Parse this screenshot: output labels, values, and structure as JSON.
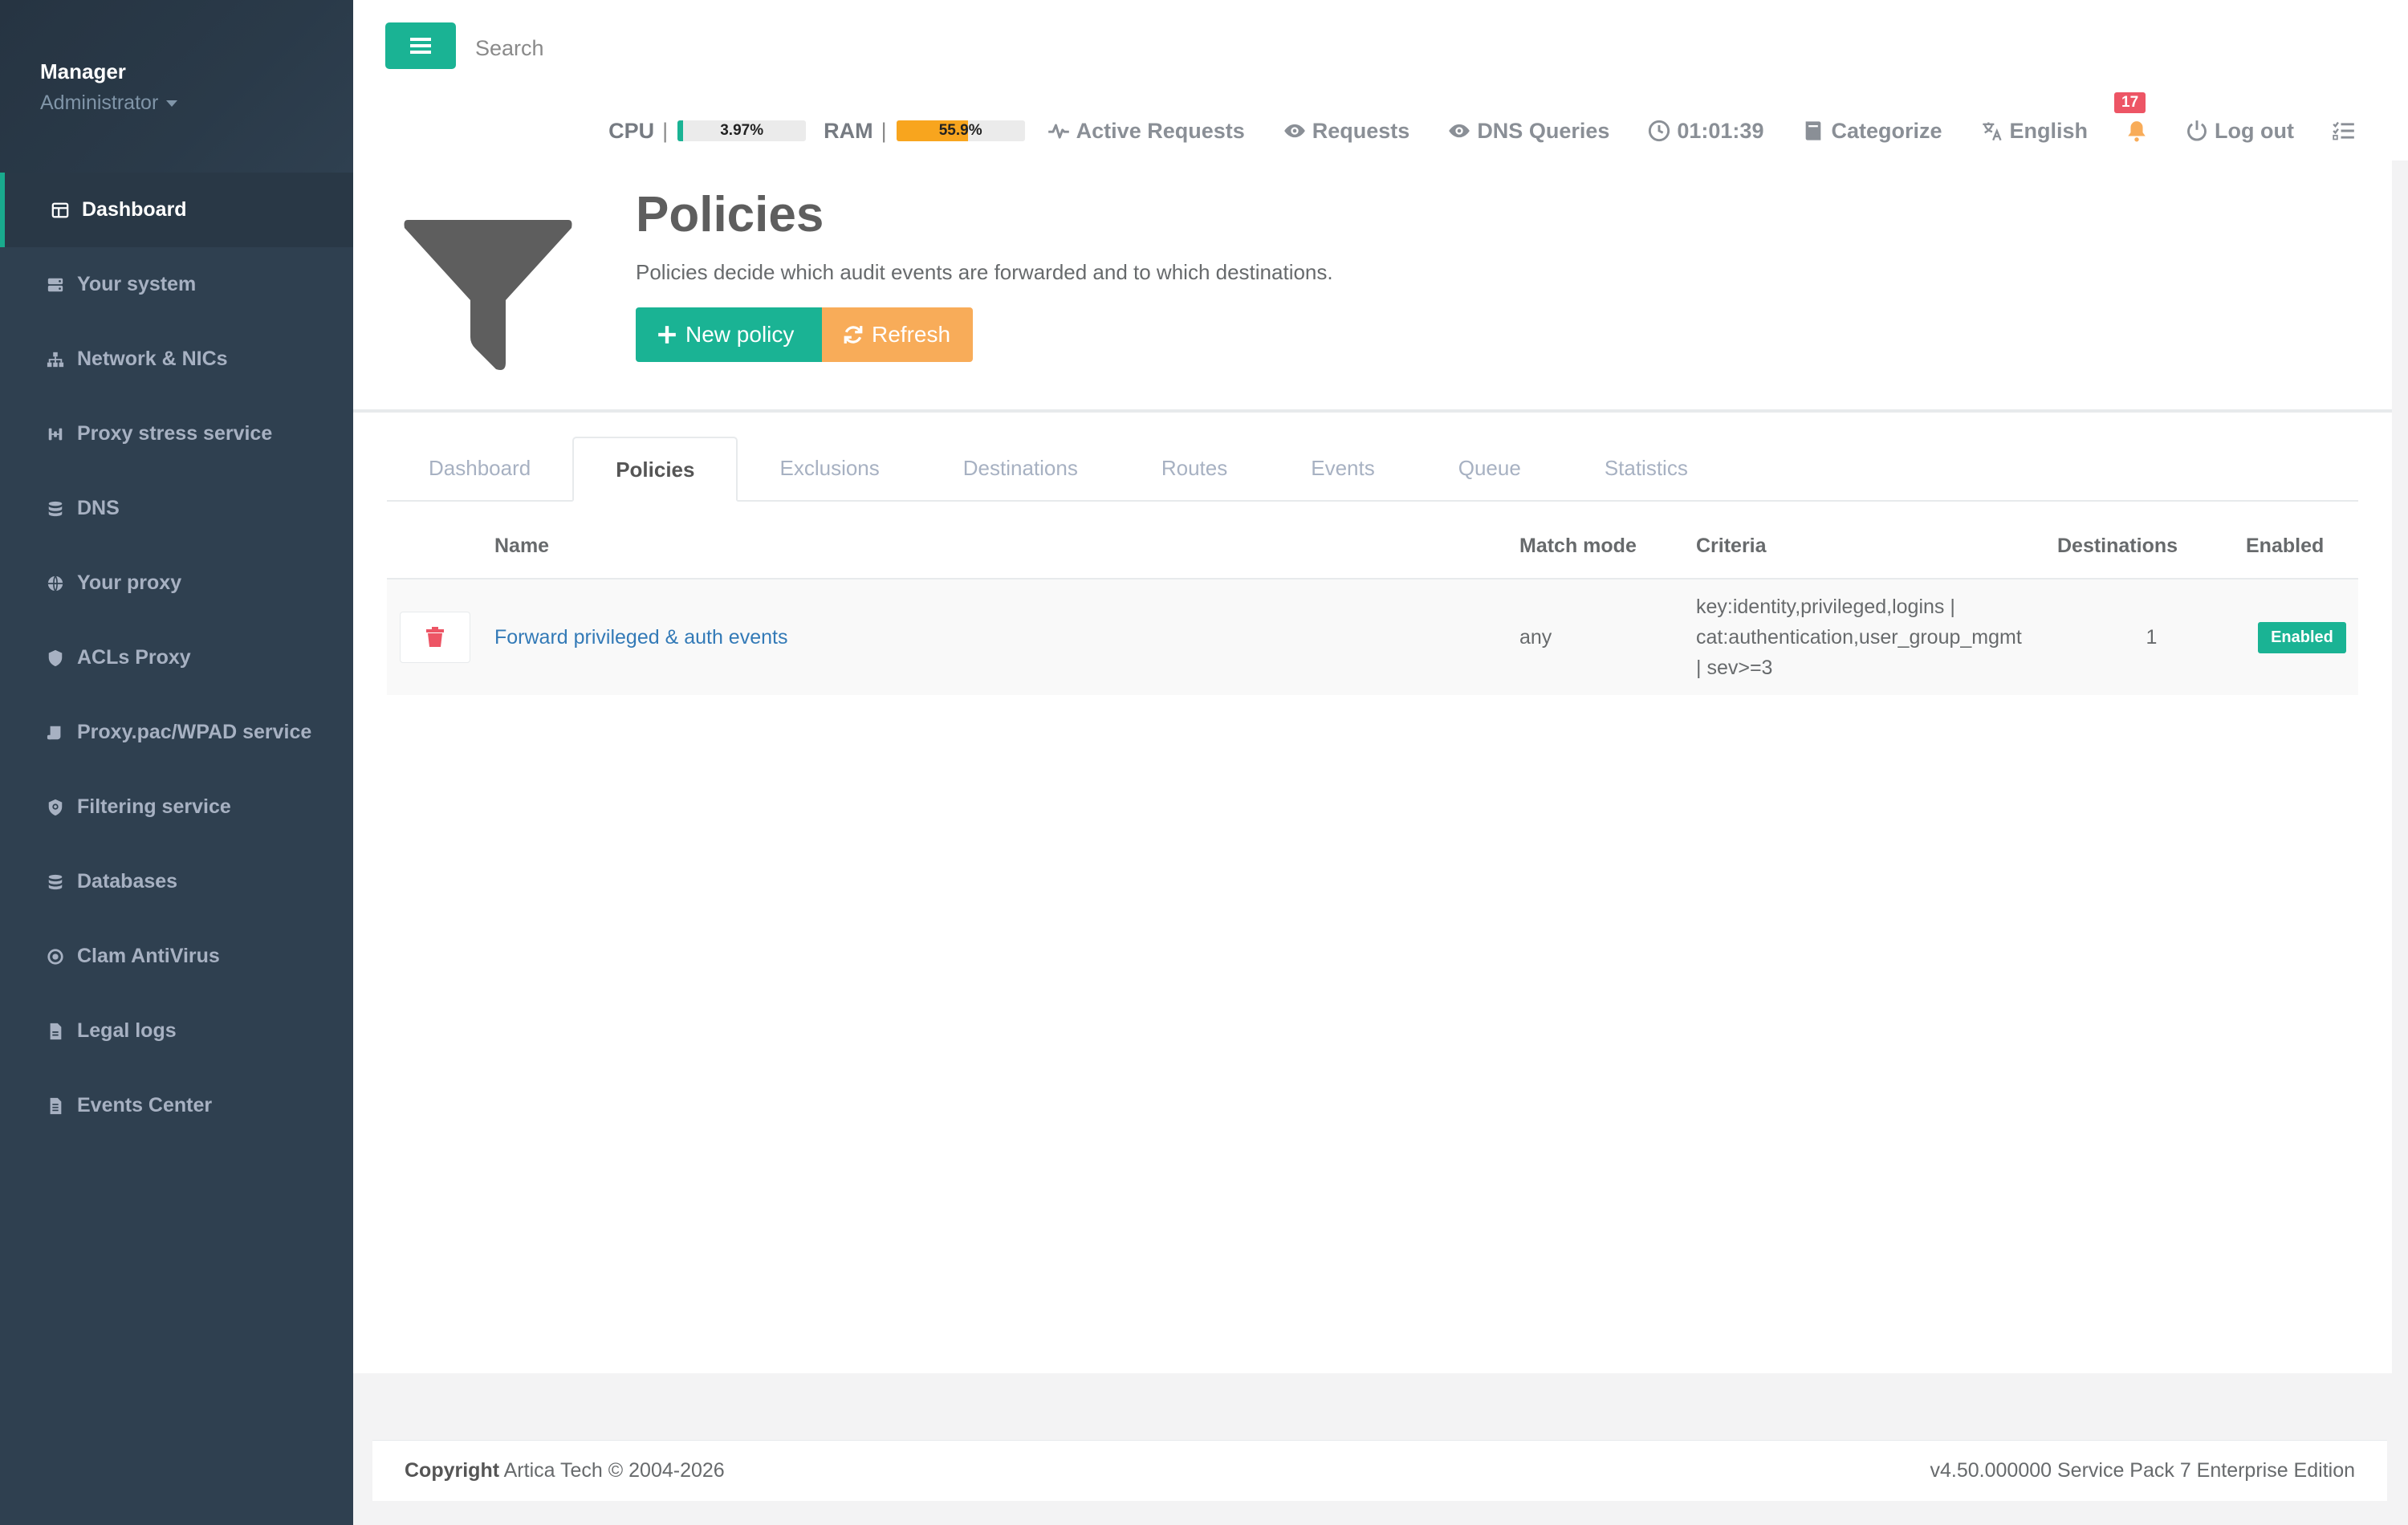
{
  "sidebar": {
    "profile": {
      "name": "Manager",
      "role": "Administrator"
    },
    "items": [
      {
        "label": "Dashboard",
        "icon": "dashboard-icon"
      },
      {
        "label": "Your system",
        "icon": "server-icon"
      },
      {
        "label": "Network & NICs",
        "icon": "sitemap-icon"
      },
      {
        "label": "Proxy stress service",
        "icon": "stress-icon"
      },
      {
        "label": "DNS",
        "icon": "database-icon"
      },
      {
        "label": "Your proxy",
        "icon": "globe-icon"
      },
      {
        "label": "ACLs Proxy",
        "icon": "shield-icon"
      },
      {
        "label": "Proxy.pac/WPAD service",
        "icon": "script-icon"
      },
      {
        "label": "Filtering service",
        "icon": "shield-virus-icon"
      },
      {
        "label": "Databases",
        "icon": "database-icon"
      },
      {
        "label": "Clam AntiVirus",
        "icon": "virus-icon"
      },
      {
        "label": "Legal logs",
        "icon": "file-icon"
      },
      {
        "label": "Events Center",
        "icon": "file-lines-icon"
      }
    ]
  },
  "topbar": {
    "search_placeholder": "Search",
    "cpu_label": "CPU",
    "cpu_value": "3.97%",
    "cpu_level": 0.0397,
    "ram_label": "RAM",
    "ram_value": "55.9%",
    "ram_level": 0.559,
    "sep": "|",
    "active_requests": "Active Requests",
    "requests": "Requests",
    "dns_queries": "DNS Queries",
    "clock": "01:01:39",
    "categorize": "Categorize",
    "language": "English",
    "notifications": "17",
    "logout": "Log out"
  },
  "page": {
    "title": "Policies",
    "description": "Policies decide which audit events are forwarded and to which destinations.",
    "new_policy": "New policy",
    "refresh": "Refresh"
  },
  "tabs": [
    "Dashboard",
    "Policies",
    "Exclusions",
    "Destinations",
    "Routes",
    "Events",
    "Queue",
    "Statistics"
  ],
  "active_tab": "Policies",
  "table": {
    "headers": {
      "name": "Name",
      "match_mode": "Match mode",
      "criteria": "Criteria",
      "destinations": "Destinations",
      "enabled": "Enabled"
    },
    "rows": [
      {
        "name": "Forward privileged & auth events",
        "match_mode": "any",
        "criteria_lines": [
          "key:identity,privileged,logins |",
          "cat:authentication,user_group_mgmt",
          "| sev>=3"
        ],
        "destinations": "1",
        "enabled": "Enabled"
      }
    ]
  },
  "footer": {
    "copyright_label": "Copyright",
    "copyright_text": "Artica Tech © 2004-2026",
    "version": "v4.50.000000 Service Pack 7 Enterprise Edition"
  },
  "colors": {
    "sidebar_bg": "#2f4050",
    "primary": "#1ab394",
    "warning": "#f8ac59",
    "danger": "#ed5565",
    "link": "#337ab7"
  }
}
